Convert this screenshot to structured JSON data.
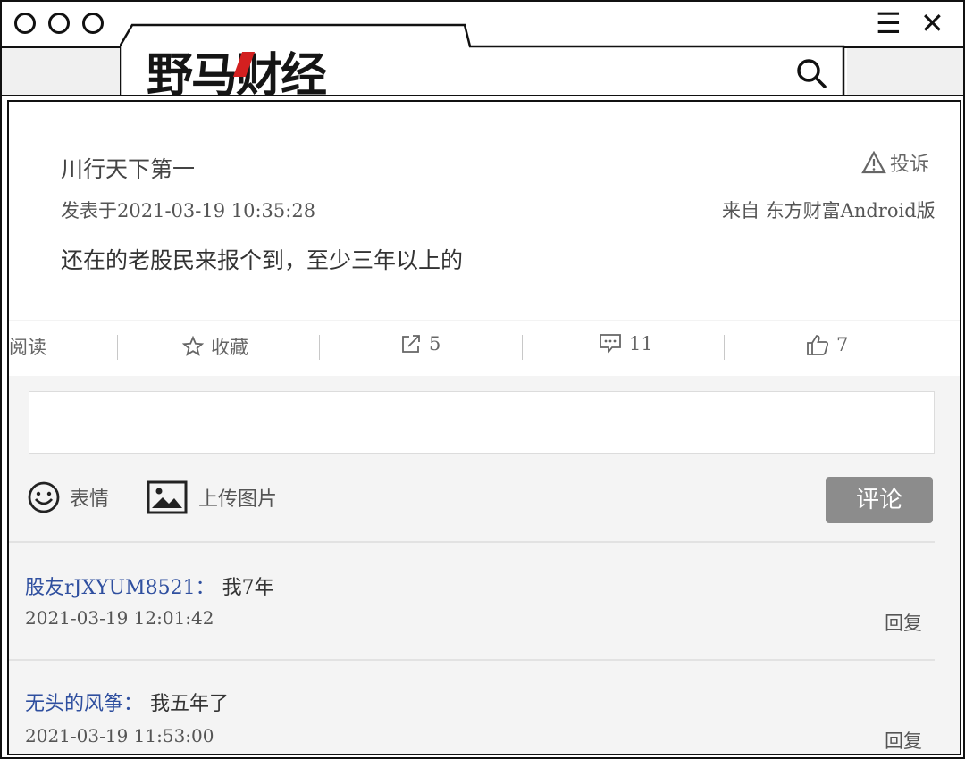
{
  "browser": {
    "logo_text": "野马财经",
    "menu_icon": "hamburger-icon",
    "close_icon": "close-icon",
    "search_icon": "search-icon"
  },
  "post": {
    "author": "川行天下第一",
    "report_label": "投诉",
    "published": "发表于2021-03-19 10:35:28",
    "source": "来自 东方财富Android版",
    "content": "还在的老股民来报个到，至少三年以上的"
  },
  "actions": {
    "read_label": "阅读",
    "favorite_label": "收藏",
    "share_count": "5",
    "comment_count": "11",
    "like_count": "7"
  },
  "composer": {
    "emoji_label": "表情",
    "upload_label": "上传图片",
    "submit_label": "评论"
  },
  "comments": [
    {
      "user": "股友rJXYUM8521",
      "sep": "：",
      "text": "我7年",
      "time": "2021-03-19 12:01:42",
      "reply": "回复"
    },
    {
      "user": "无头的风筝",
      "sep": "：",
      "text": "我五年了",
      "time": "2021-03-19 11:53:00",
      "reply": "回复"
    }
  ],
  "colors": {
    "username": "#2f4f9f",
    "submit_bg": "#8c8c8c",
    "logo_accent": "#d32020"
  }
}
